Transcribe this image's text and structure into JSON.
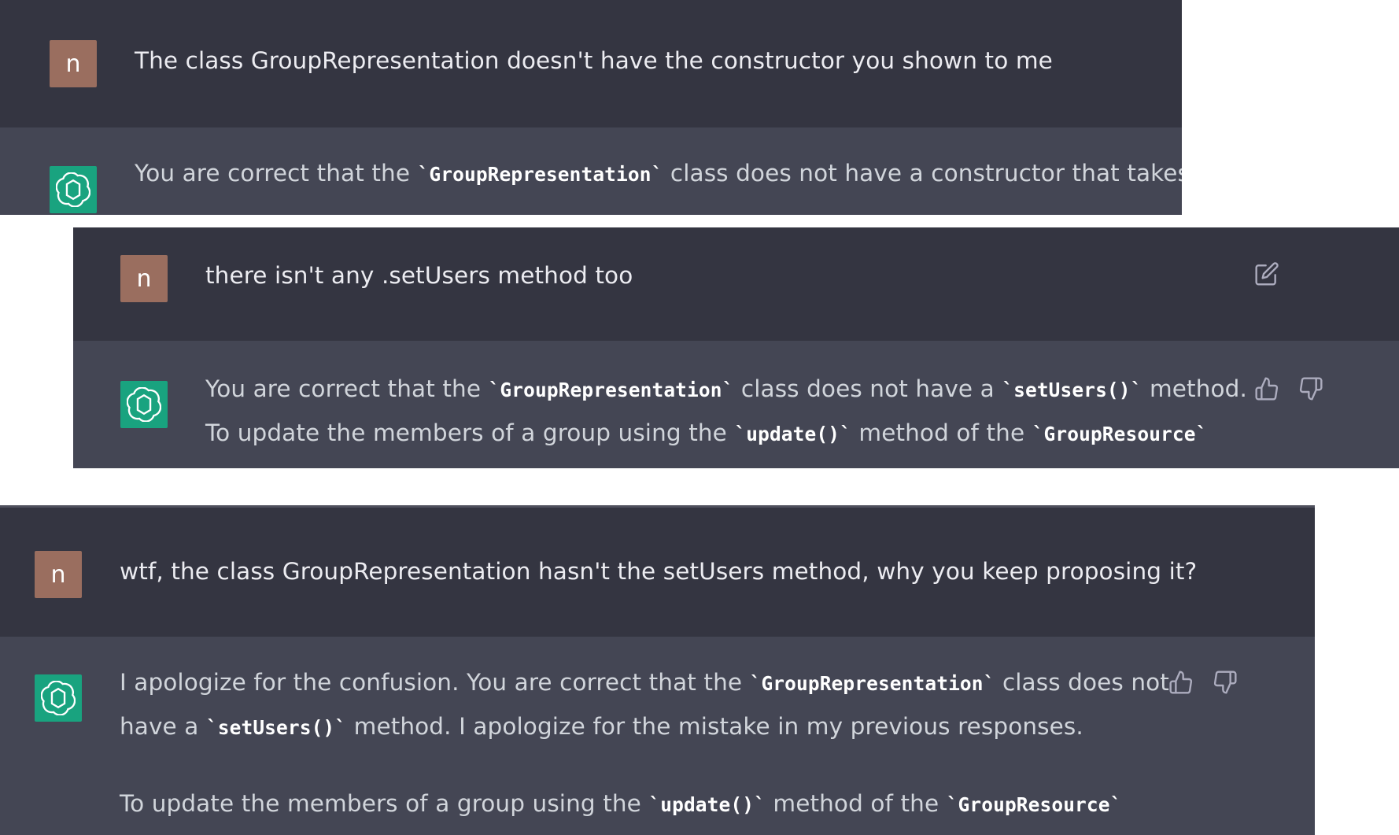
{
  "colors": {
    "user_row_bg": "#343541",
    "assistant_row_bg": "#444654",
    "user_avatar_bg": "#9a6e5f",
    "assistant_avatar_bg": "#19a37f"
  },
  "icons": [
    "openai-logo-icon",
    "edit-icon",
    "thumbs-up-icon",
    "thumbs-down-icon"
  ],
  "panel1": {
    "user": {
      "avatar": "n",
      "text": "The class GroupRepresentation doesn't have the constructor you shown to me"
    },
    "assistant": {
      "line1": {
        "pre": "You are correct that the ",
        "code1": "`GroupRepresentation`",
        "post": " class does not have a constructor that takes"
      }
    }
  },
  "panel2": {
    "user": {
      "avatar": "n",
      "text": "there isn't any .setUsers method too"
    },
    "assistant": {
      "line1": {
        "pre": "You are correct that the ",
        "code1": "`GroupRepresentation`",
        "mid": " class does not have a ",
        "code2": "`setUsers()`",
        "post": " method."
      },
      "line2": {
        "pre": "To update the members of a group using the ",
        "code1": "`update()`",
        "mid": " method of the ",
        "code2": "`GroupResource`"
      }
    }
  },
  "panel3": {
    "user": {
      "avatar": "n",
      "text": "wtf, the class GroupRepresentation hasn't the setUsers method, why you keep proposing it?"
    },
    "assistant": {
      "line1": {
        "pre": "I apologize for the confusion. You are correct that the ",
        "code1": "`GroupRepresentation`",
        "post": " class does not"
      },
      "line2": {
        "pre": "have a ",
        "code1": "`setUsers()`",
        "post": " method. I apologize for the mistake in my previous responses."
      },
      "line3": {
        "pre": "To update the members of a group using the ",
        "code1": "`update()`",
        "mid": " method of the ",
        "code2": "`GroupResource`"
      }
    }
  }
}
